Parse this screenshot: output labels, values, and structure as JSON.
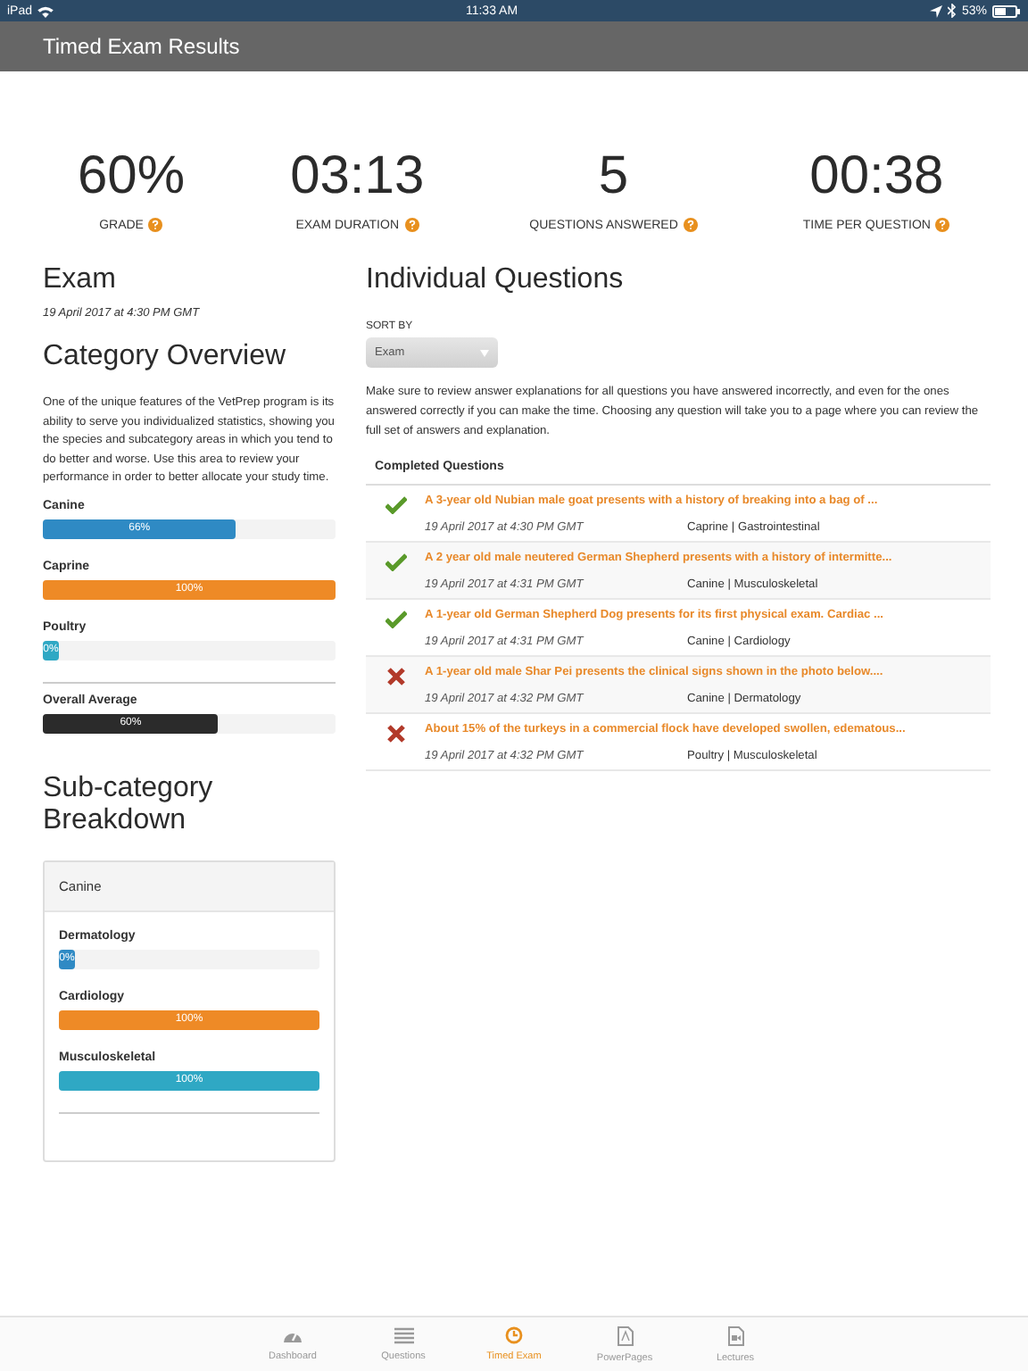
{
  "status_bar": {
    "device": "iPad",
    "time": "11:33 AM",
    "battery": "53%"
  },
  "header": {
    "title": "Timed Exam Results"
  },
  "stats": [
    {
      "value": "60%",
      "label": "GRADE"
    },
    {
      "value": "03:13",
      "label": "EXAM DURATION"
    },
    {
      "value": "5",
      "label": "QUESTIONS ANSWERED"
    },
    {
      "value": "00:38",
      "label": "TIME PER QUESTION"
    }
  ],
  "exam": {
    "title": "Exam",
    "date": "19 April 2017 at 4:30 PM GMT"
  },
  "category_overview": {
    "title": "Category Overview",
    "description": "One of the unique features of the VetPrep program is its ability to serve you individualized statistics, showing you the species and subcategory areas in which you tend to do better and worse. Use this area to review your performance in order to better allocate your study time.",
    "bars": [
      {
        "name": "Canine",
        "level": 0.66,
        "reading": "66%",
        "color": "#2f8ac4"
      },
      {
        "name": "Caprine",
        "level": 1,
        "reading": "100%",
        "color": "#ee8a26"
      },
      {
        "name": "Poultry",
        "level": 0,
        "reading": "0%",
        "color": "#2fa8c4"
      }
    ],
    "average": {
      "name": "Overall Average",
      "level": 0.6,
      "reading": "60%",
      "color": "#2b2b2b"
    }
  },
  "subcategory": {
    "title": "Sub-category Breakdown",
    "panel_title": "Canine",
    "bars": [
      {
        "name": "Dermatology",
        "level": 0,
        "reading": "0%",
        "color": "#2f8ac4"
      },
      {
        "name": "Cardiology",
        "level": 1,
        "reading": "100%",
        "color": "#ee8a26"
      },
      {
        "name": "Musculoskeletal",
        "level": 1,
        "reading": "100%",
        "color": "#2fa8c4"
      }
    ]
  },
  "individual": {
    "title": "Individual Questions",
    "sort_label": "SORT BY",
    "sort_value": "Exam",
    "description": "Make sure to review answer explanations for all questions you have answered incorrectly, and even for the ones answered correctly if you can make the time. Choosing any question will take you to a page where you can review the full set of answers and explanation.",
    "list_title": "Completed Questions",
    "questions": [
      {
        "kind": "correct",
        "text": "A 3-year old Nubian male goat presents with a history of breaking into a bag of ...",
        "date": "19 April 2017 at 4:30 PM GMT",
        "category": "Caprine | Gastrointestinal"
      },
      {
        "kind": "correct",
        "text": "A 2 year old male neutered German Shepherd presents with a history of intermitte...",
        "date": "19 April 2017 at 4:31 PM GMT",
        "category": "Canine | Musculoskeletal"
      },
      {
        "kind": "correct",
        "text": "A 1-year old German Shepherd Dog presents for its first physical exam. Cardiac ...",
        "date": "19 April 2017 at 4:31 PM GMT",
        "category": "Canine | Cardiology"
      },
      {
        "kind": "incorrect",
        "text": "A 1-year old male Shar Pei presents the clinical signs shown in the photo below....",
        "date": "19 April 2017 at 4:32 PM GMT",
        "category": "Canine | Dermatology"
      },
      {
        "kind": "incorrect",
        "text": "About 15% of the turkeys in a commercial flock have developed swollen, edematous...",
        "date": "19 April 2017 at 4:32 PM GMT",
        "category": "Poultry | Musculoskeletal"
      }
    ]
  },
  "tab_bar": [
    {
      "kind": "dashboard",
      "label": "Dashboard",
      "selected": false
    },
    {
      "kind": "questions",
      "label": "Questions",
      "selected": false
    },
    {
      "kind": "timer",
      "label": "Timed Exam",
      "selected": true
    },
    {
      "kind": "pdf",
      "label": "PowerPages",
      "selected": false
    },
    {
      "kind": "video",
      "label": "Lectures",
      "selected": false
    }
  ]
}
